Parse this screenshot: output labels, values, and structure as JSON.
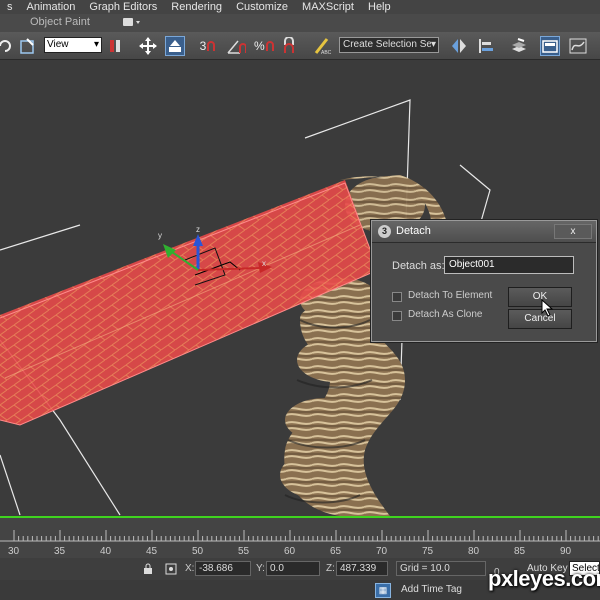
{
  "menu": {
    "items": [
      "s",
      "Animation",
      "Graph Editors",
      "Rendering",
      "Customize",
      "MAXScript",
      "Help"
    ]
  },
  "ribbon": {
    "label": "Object Paint"
  },
  "toolbar": {
    "view_select": "View",
    "selection_set_placeholder": "Create Selection Se",
    "snap_label": "3",
    "percent_label": "%"
  },
  "dialog": {
    "title": "Detach",
    "detach_as_label": "Detach as:",
    "detach_as_value": "Object001",
    "detach_to_element": "Detach To Element",
    "detach_as_clone": "Detach As Clone",
    "ok_label": "OK",
    "cancel_label": "Cancel",
    "close_glyph": "x"
  },
  "timeline": {
    "ticks": [
      "30",
      "35",
      "40",
      "45",
      "50",
      "55",
      "60",
      "65",
      "70",
      "75",
      "80",
      "85",
      "90"
    ]
  },
  "status": {
    "x_label": "X:",
    "x_value": "-38.686",
    "y_label": "Y:",
    "y_value": "0.0",
    "z_label": "Z:",
    "z_value": "487.339",
    "grid": "Grid = 10.0",
    "auto_key": "Auto Key",
    "selected": "Selecte",
    "add_time_tag": "Add Time Tag",
    "zero": "0"
  },
  "watermark": "pxleyes.com",
  "colors": {
    "accent": "#3a5f8c",
    "viewport_border": "#3fd41f",
    "selection_red": "#e84a4a"
  }
}
